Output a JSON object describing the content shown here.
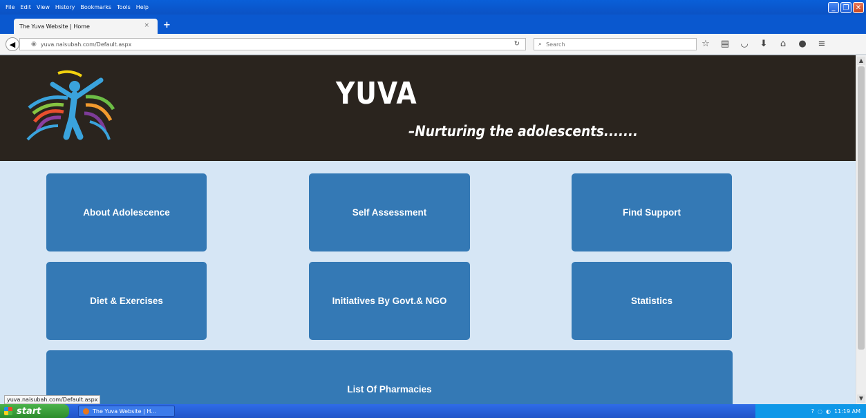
{
  "menu": [
    "File",
    "Edit",
    "View",
    "History",
    "Bookmarks",
    "Tools",
    "Help"
  ],
  "tab": {
    "title": "The Yuva Website | Home",
    "close": "×",
    "new_tab": "+"
  },
  "nav": {
    "url": "yuva.naisubah.com/Default.aspx",
    "search_placeholder": "Search"
  },
  "banner": {
    "title": "YUVA",
    "tagline": "–Nurturing the adolescents......."
  },
  "tiles": [
    "About Adolescence",
    "Self Assessment",
    "Find Support",
    "Diet & Exercises",
    "Initiatives By Govt.& NGO",
    "Statistics",
    "List Of Pharmacies"
  ],
  "status_url": "yuva.naisubah.com/Default.aspx",
  "taskbar": {
    "start": "start",
    "task_label": "The Yuva Website | H...",
    "clock": "11:19 AM"
  },
  "colors": {
    "tile": "#3479b5",
    "page_bg": "#d6e6f5",
    "banner_bg": "#2a241e"
  }
}
